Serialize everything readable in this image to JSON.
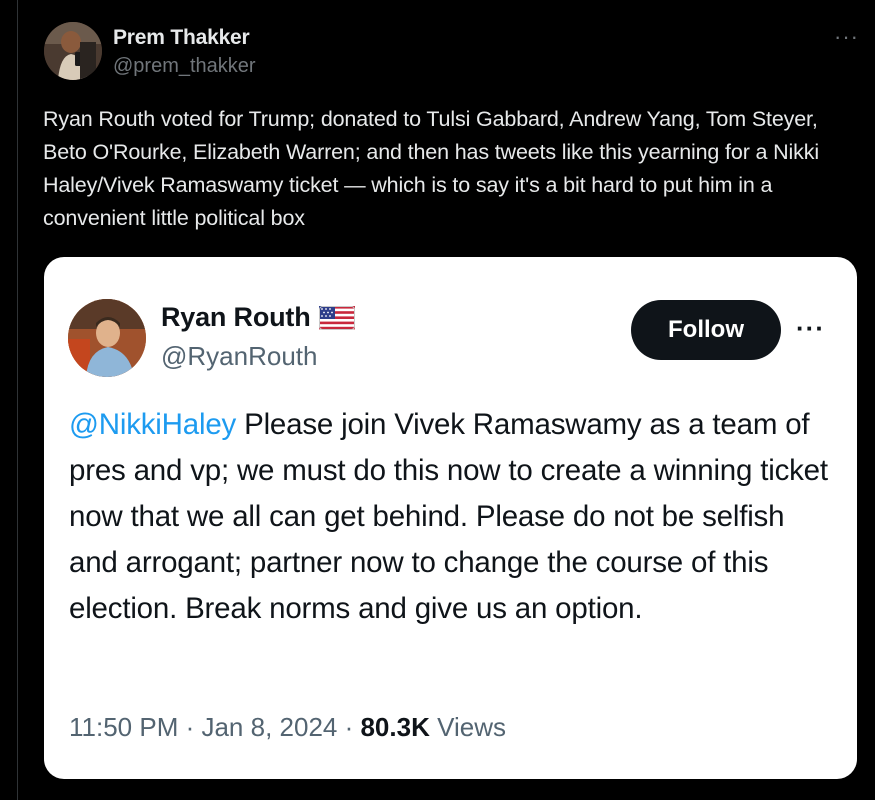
{
  "post": {
    "author_name": "Prem Thakker",
    "author_handle": "@prem_thakker",
    "more_glyph": "···",
    "text": "Ryan Routh voted for Trump; donated to Tulsi Gabbard, Andrew Yang, Tom Steyer, Beto O'Rourke, Elizabeth Warren; and then has tweets like this yearning for a Nikki Haley/Vivek Ramaswamy ticket — which is to say it's a bit hard to put him in a convenient little political box"
  },
  "quoted": {
    "author_name": "Ryan Routh",
    "author_handle": "@RyanRouth",
    "flag_icon": "us-flag-icon",
    "follow_label": "Follow",
    "more_glyph": "···",
    "mention": "@NikkiHaley",
    "text": " Please join Vivek Ramaswamy as a team  of pres and vp; we must do this now to create a winning ticket now that we all can get behind. Please do not be selfish and arrogant; partner now to change the course of this election. Break norms and give us an option.",
    "time": "11:50 PM",
    "separator": " · ",
    "date": "Jan 8, 2024",
    "views_count": "80.3K",
    "views_label": " Views"
  },
  "colors": {
    "background": "#000000",
    "card": "#ffffff",
    "link": "#1d9bf0",
    "follow_button": "#0f1419"
  }
}
